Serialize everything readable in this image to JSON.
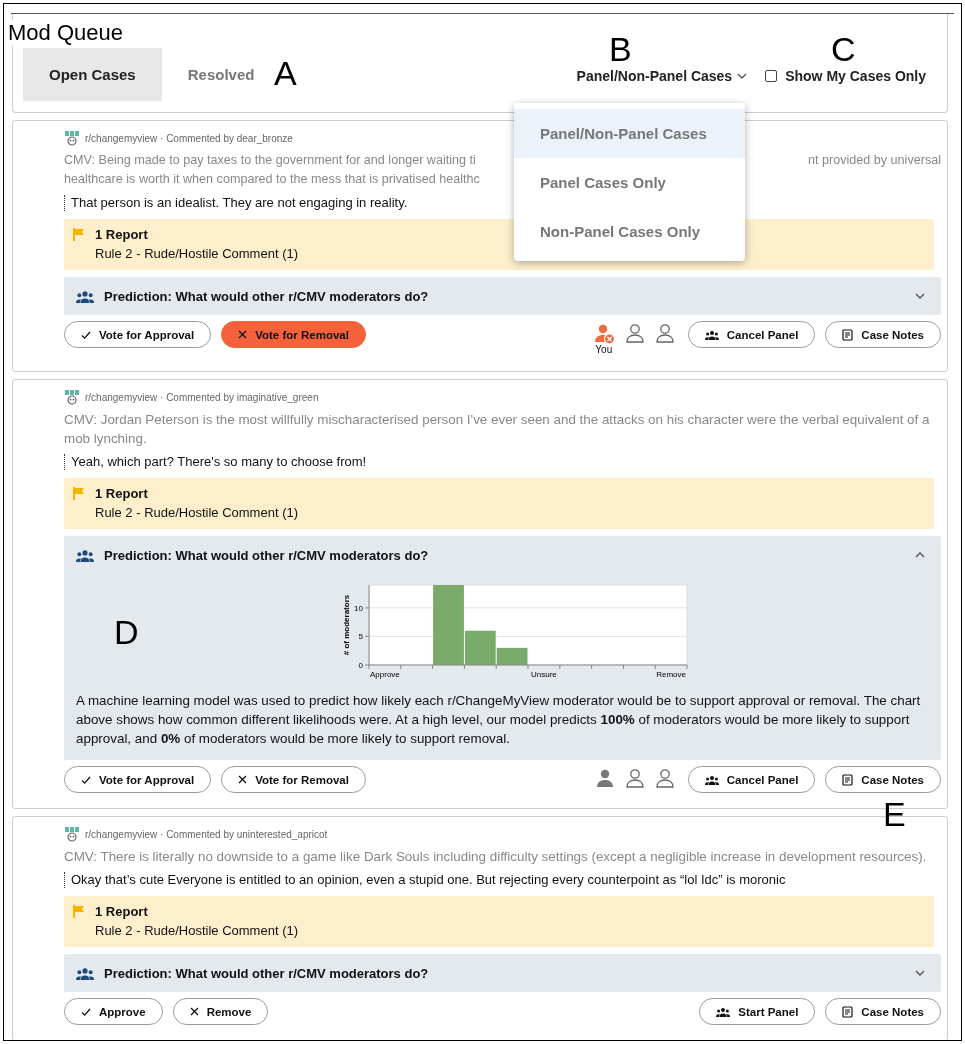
{
  "page": {
    "title": "Mod Queue"
  },
  "tabs": [
    {
      "label": "Open Cases",
      "selected": true
    },
    {
      "label": "Resolved",
      "selected": false
    }
  ],
  "filter": {
    "label": "Panel/Non-Panel Cases",
    "expanded": true,
    "options": [
      {
        "label": "Panel/Non-Panel Cases",
        "selected": true
      },
      {
        "label": "Panel Cases Only",
        "selected": false
      },
      {
        "label": "Non-Panel Cases Only",
        "selected": false
      }
    ]
  },
  "my_cases": {
    "label": "Show My Cases Only",
    "checked": false
  },
  "cases": [
    {
      "meta": "r/changemyview · Commented by dear_bronze",
      "title_segments": [
        "CMV: Being made to pay taxes to the government for and longer waiting ti",
        "nt provided by universal",
        "healthcare is worth it when compared to the mess that is privatised healthc"
      ],
      "comment": "That person is an idealist. They are not engaging in reality.",
      "report": {
        "count": "1 Report",
        "rule": "Rule 2 - Rude/Hostile Comment (1)"
      },
      "prediction": {
        "label": "Prediction: What would other r/CMV moderators do?",
        "expanded": false
      },
      "actions": [
        {
          "kind": "approve",
          "label": "Vote for Approval",
          "selected": false
        },
        {
          "kind": "remove",
          "label": "Vote for Removal",
          "selected": true
        }
      ],
      "panel": {
        "voters": [
          {
            "voted": true,
            "removal": true,
            "label": "You"
          },
          {
            "voted": false
          },
          {
            "voted": false
          }
        ],
        "button": "Cancel Panel"
      },
      "notes_button": "Case Notes"
    },
    {
      "meta": "r/changemyview · Commented by imaginative_green",
      "title": "CMV: Jordan Peterson is the most willfully mischaracterised person I've ever seen and the attacks on his character were the verbal equivalent of a mob lynching.",
      "comment": "Yeah, which part? There's so many to choose from!",
      "report": {
        "count": "1 Report",
        "rule": "Rule 2 - Rude/Hostile Comment (1)"
      },
      "prediction": {
        "label": "Prediction: What would other r/CMV moderators do?",
        "expanded": true,
        "chart_data": {
          "type": "bar",
          "ylabel": "# of moderators",
          "categories": [
            "Approve",
            null,
            null,
            null,
            null,
            "Unsure",
            null,
            null,
            null,
            "Remove"
          ],
          "values": [
            0,
            0,
            14,
            6,
            3,
            0,
            0,
            0,
            0,
            0
          ],
          "ylim": [
            0,
            14
          ],
          "yticks": [
            0,
            5,
            10
          ]
        },
        "explanation": "A machine learning model was used to predict how likely each r/ChangeMyView moderator would be to support approval or removal. The chart above shows how common different likelihoods were. At a high level, our model predicts **100%** of moderators would be more likely to support approval, and **0%** of moderators would be more likely to support removal."
      },
      "actions": [
        {
          "kind": "approve",
          "label": "Vote for Approval",
          "selected": false
        },
        {
          "kind": "remove",
          "label": "Vote for Removal",
          "selected": false
        }
      ],
      "panel": {
        "voters": [
          {
            "voted": true,
            "removal": false
          },
          {
            "voted": false
          },
          {
            "voted": false
          }
        ],
        "button": "Cancel Panel"
      },
      "notes_button": "Case Notes"
    },
    {
      "meta": "r/changemyview · Commented by uninterested_apricot",
      "title": "CMV: There is literally no downside to a game like Dark Souls including difficulty settings (except a negligible increase in development resources).",
      "comment": "Okay that’s cute Everyone is entitled to an opinion, even a stupid one. But rejecting every counterpoint as “lol Idc” is moronic",
      "report": {
        "count": "1 Report",
        "rule": "Rule 2 - Rude/Hostile Comment (1)"
      },
      "prediction": {
        "label": "Prediction: What would other r/CMV moderators do?",
        "expanded": false
      },
      "actions": [
        {
          "kind": "approve",
          "label": "Approve",
          "selected": false
        },
        {
          "kind": "remove",
          "label": "Remove",
          "selected": false
        }
      ],
      "panel": {
        "button": "Start Panel"
      },
      "notes_button": "Case Notes"
    }
  ],
  "annotations": [
    {
      "label": "A"
    },
    {
      "label": "B"
    },
    {
      "label": "C"
    },
    {
      "label": "D"
    },
    {
      "label": "E"
    }
  ]
}
